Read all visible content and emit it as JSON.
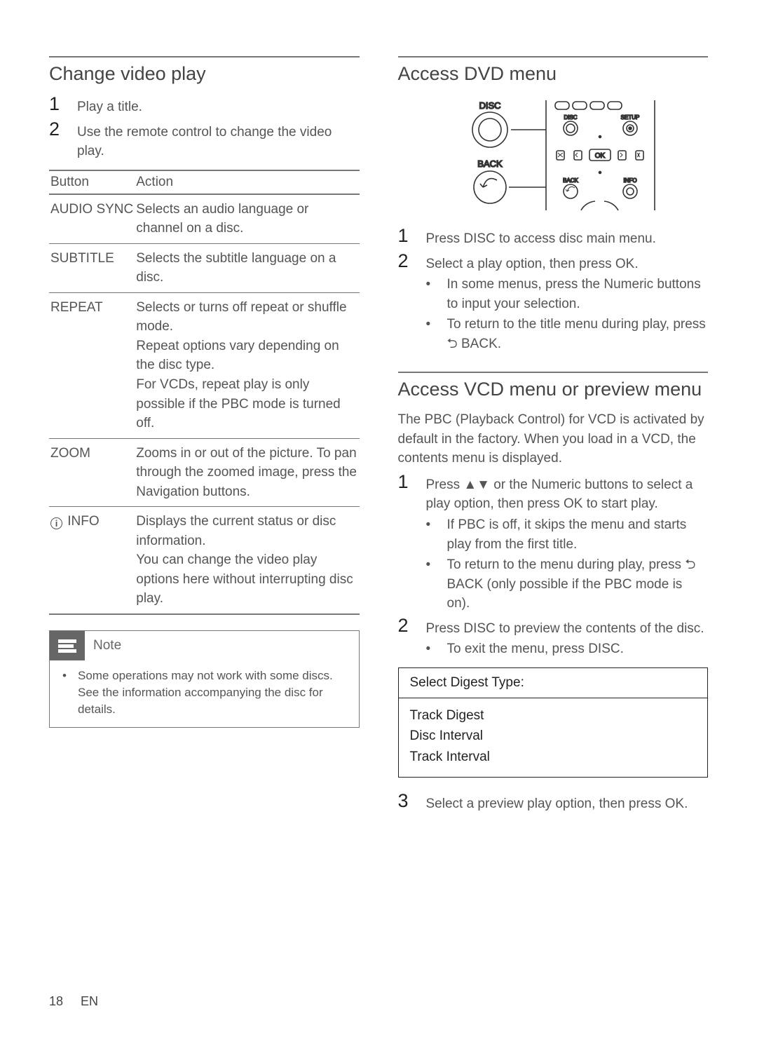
{
  "left": {
    "section_title": "Change video play",
    "steps": [
      {
        "num": "1",
        "text": "Play a title."
      },
      {
        "num": "2",
        "text": "Use the remote control to change the video play."
      }
    ],
    "table": {
      "h1": "Button",
      "h2": "Action",
      "rows": [
        {
          "btn": "AUDIO SYNC",
          "act": "Selects an audio language or channel on a disc."
        },
        {
          "btn": "SUBTITLE",
          "act": "Selects the subtitle language on a disc."
        },
        {
          "btn": "REPEAT",
          "act": "Selects or turns off repeat or shuffle mode.\nRepeat options vary depending on the disc type.\nFor VCDs, repeat play is only possible if the PBC mode is turned off."
        },
        {
          "btn": "ZOOM",
          "act": "Zooms in or out of the picture. To pan through the zoomed image, press the Navigation buttons."
        },
        {
          "btn": "INFO",
          "info_icon": true,
          "act": "Displays the current status or disc information.\nYou can change the video play options here without interrupting disc play."
        }
      ]
    },
    "note": {
      "label": "Note",
      "text": "Some operations may not work with some discs. See the information accompanying the disc for details."
    }
  },
  "right": {
    "section1_title": "Access DVD menu",
    "diagram": {
      "labels": {
        "disc": "DISC",
        "back": "BACK",
        "ok": "OK",
        "top_disc": "DISC",
        "top_setup": "SETUP",
        "bot_back": "BACK",
        "bot_info": "INFO"
      }
    },
    "s1_steps": [
      {
        "num": "1",
        "text": "Press DISC to access disc main menu."
      },
      {
        "num": "2",
        "text": "Select a play option, then press OK.",
        "bullets": [
          "In some menus, press the Numeric buttons to input your selection.",
          "To return to the title menu during play, press ⮌ BACK."
        ]
      }
    ],
    "section2_title": "Access VCD menu or preview menu",
    "intro": "The PBC (Playback Control) for VCD is activated by default in the factory. When you load in a VCD, the contents menu is displayed.",
    "s2_steps_a": [
      {
        "num": "1",
        "text": "Press ▲▼ or the Numeric buttons to select a play option, then press OK to start play.",
        "bullets": [
          "If PBC is off, it skips the menu and starts play from the first title.",
          "To return to the menu during play, press ⮌ BACK (only possible if the PBC mode is on)."
        ]
      },
      {
        "num": "2",
        "text": "Press DISC to preview the contents of the disc.",
        "bullets": [
          "To exit the menu, press DISC."
        ]
      }
    ],
    "ui_box": {
      "title": "Select Digest Type:",
      "items": [
        "Track Digest",
        "Disc Interval",
        "Track Interval"
      ]
    },
    "s2_steps_b": [
      {
        "num": "3",
        "text": "Select a preview play option, then press OK."
      }
    ]
  },
  "footer": {
    "page": "18",
    "lang": "EN"
  }
}
